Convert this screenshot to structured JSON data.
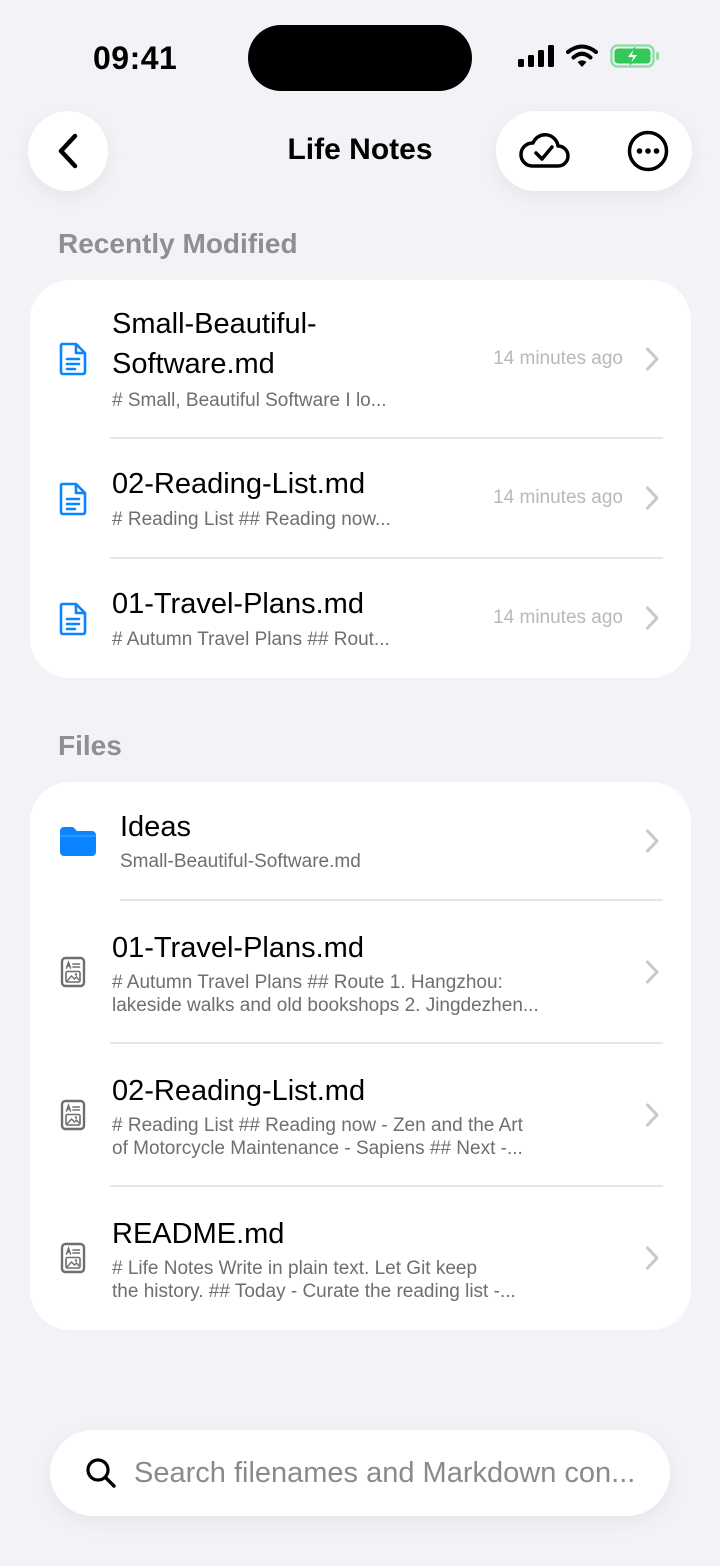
{
  "status_bar": {
    "time": "09:41"
  },
  "nav": {
    "title": "Life Notes",
    "back_icon": "chevron-left-icon",
    "sync_icon": "cloud-check-icon",
    "more_icon": "ellipsis-circle-icon"
  },
  "recent": {
    "header": "Recently Modified",
    "items": [
      {
        "name_line1": "Small-Beautiful-",
        "name_line2": "Software.md",
        "preview": "# Small, Beautiful Software I lo...",
        "time": "14 minutes ago"
      },
      {
        "name": "02-Reading-List.md",
        "preview": "# Reading List ## Reading now...",
        "time": "14 minutes ago"
      },
      {
        "name": "01-Travel-Plans.md",
        "preview": "# Autumn Travel Plans ## Rout...",
        "time": "14 minutes ago"
      }
    ]
  },
  "files": {
    "header": "Files",
    "folder": {
      "name": "Ideas",
      "subtitle": "Small-Beautiful-Software.md"
    },
    "items": [
      {
        "name": "01-Travel-Plans.md",
        "preview_line1": "# Autumn Travel Plans ## Route 1. Hangzhou:",
        "preview_line2": "lakeside walks and old bookshops 2. Jingdezhen..."
      },
      {
        "name": "02-Reading-List.md",
        "preview_line1": "# Reading List ## Reading now - Zen and the Art",
        "preview_line2": "of Motorcycle Maintenance - Sapiens ## Next -..."
      },
      {
        "name": "README.md",
        "preview_line1": "# Life Notes Write in plain text. Let Git keep",
        "preview_line2": "the history. ## Today - Curate the reading list -..."
      }
    ]
  },
  "search": {
    "placeholder": "Search filenames and Markdown con..."
  },
  "colors": {
    "accent": "#0A84FF",
    "battery": "#34C759",
    "background": "#F2F2F7"
  }
}
